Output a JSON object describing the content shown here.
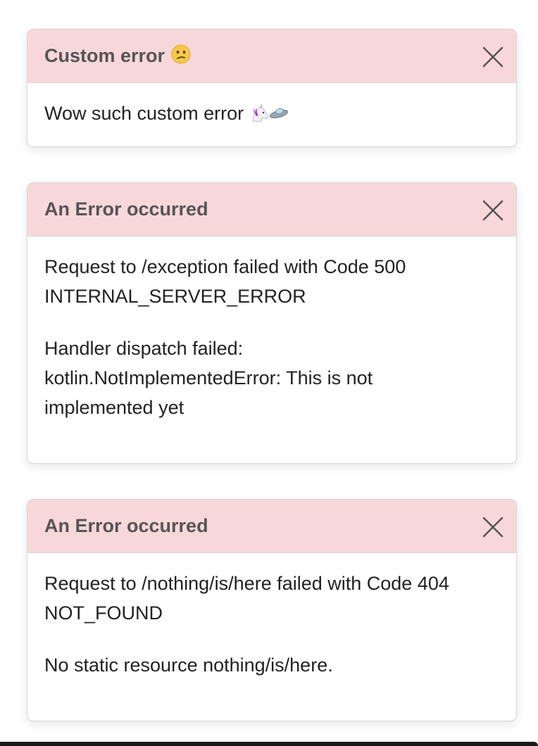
{
  "toasts": [
    {
      "title": "Custom error",
      "title_emoji": "confused-face-emoji",
      "paragraphs": [
        "Wow such custom error"
      ],
      "body_emoji": "unicorn-ufo-emoji"
    },
    {
      "title": "An Error occurred",
      "paragraphs": [
        "Request to /exception failed with Code 500 INTERNAL_SERVER_ERROR",
        "Handler dispatch failed: kotlin.NotImplementedError: This is not implemented yet"
      ]
    },
    {
      "title": "An Error occurred",
      "paragraphs": [
        "Request to /nothing/is/here failed with Code 404 NOT_FOUND",
        "No static resource nothing/is/here."
      ]
    }
  ],
  "colors": {
    "header_bg": "#f8d7da",
    "title_text": "#555555",
    "body_text": "#222222",
    "border": "#d6d6d8"
  },
  "icons": {
    "close": "close-icon"
  }
}
